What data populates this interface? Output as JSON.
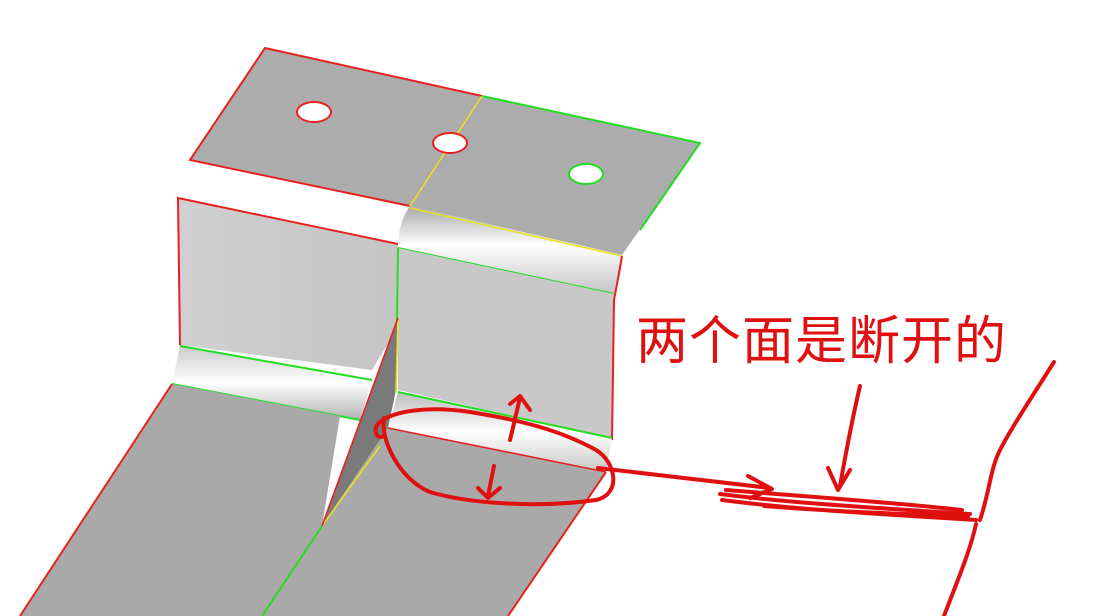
{
  "annotation": {
    "text": "两个面是断开的",
    "color": "#e01010"
  },
  "model": {
    "face_color": "#aaaaaa",
    "bend_color": "#cfcfcf",
    "edge_red": "#e82020",
    "edge_green": "#22dd22",
    "edge_yellow": "#e8e020",
    "background": "#ffffff"
  }
}
